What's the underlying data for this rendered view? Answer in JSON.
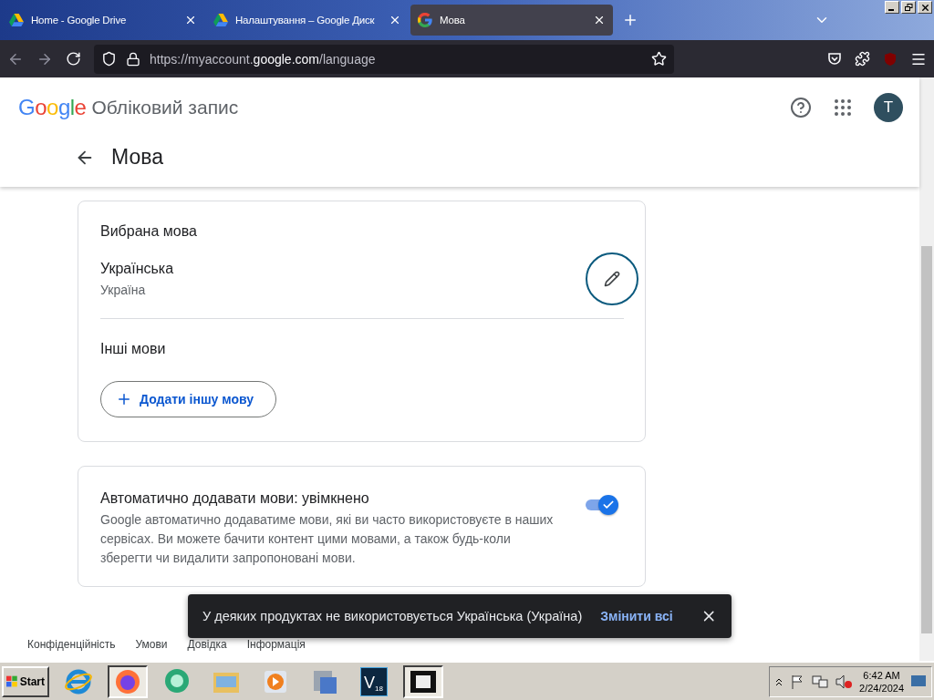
{
  "tabs": [
    {
      "title": "Home - Google Drive",
      "kind": "drive",
      "selected": false
    },
    {
      "title": "Налаштування – Google Диск",
      "kind": "drive",
      "selected": false
    },
    {
      "title": "Мова",
      "kind": "google",
      "selected": true
    }
  ],
  "address_bar": {
    "prefix": "https://myaccount.",
    "domain": "google.com",
    "path": "/language"
  },
  "header": {
    "logo": "Google",
    "product": "Обліковий запис",
    "avatar": "T"
  },
  "page_title": "Мова",
  "preferred": {
    "heading": "Вибрана мова",
    "language": "Українська",
    "region": "Україна"
  },
  "other": {
    "heading": "Інші мови",
    "add_button": "Додати іншу мову"
  },
  "auto_add": {
    "title": "Автоматично додавати мови: увімкнено",
    "description": "Google автоматично додаватиме мови, які ви часто використовуєте в наших сервісах. Ви можете бачити контент цими мовами, а також будь-коли зберегти чи видалити запропоновані мови.",
    "checked": true
  },
  "footer_links": [
    "Конфіденційність",
    "Умови",
    "Довідка",
    "Інформація"
  ],
  "snackbar": {
    "message": "У деяких продуктах не використовується Українська (Україна)",
    "action": "Змінити всі"
  },
  "taskbar": {
    "start": "Start",
    "time": "6:42 AM",
    "date": "2/24/2024",
    "vegas_label": "V",
    "vegas_sub": "18"
  }
}
